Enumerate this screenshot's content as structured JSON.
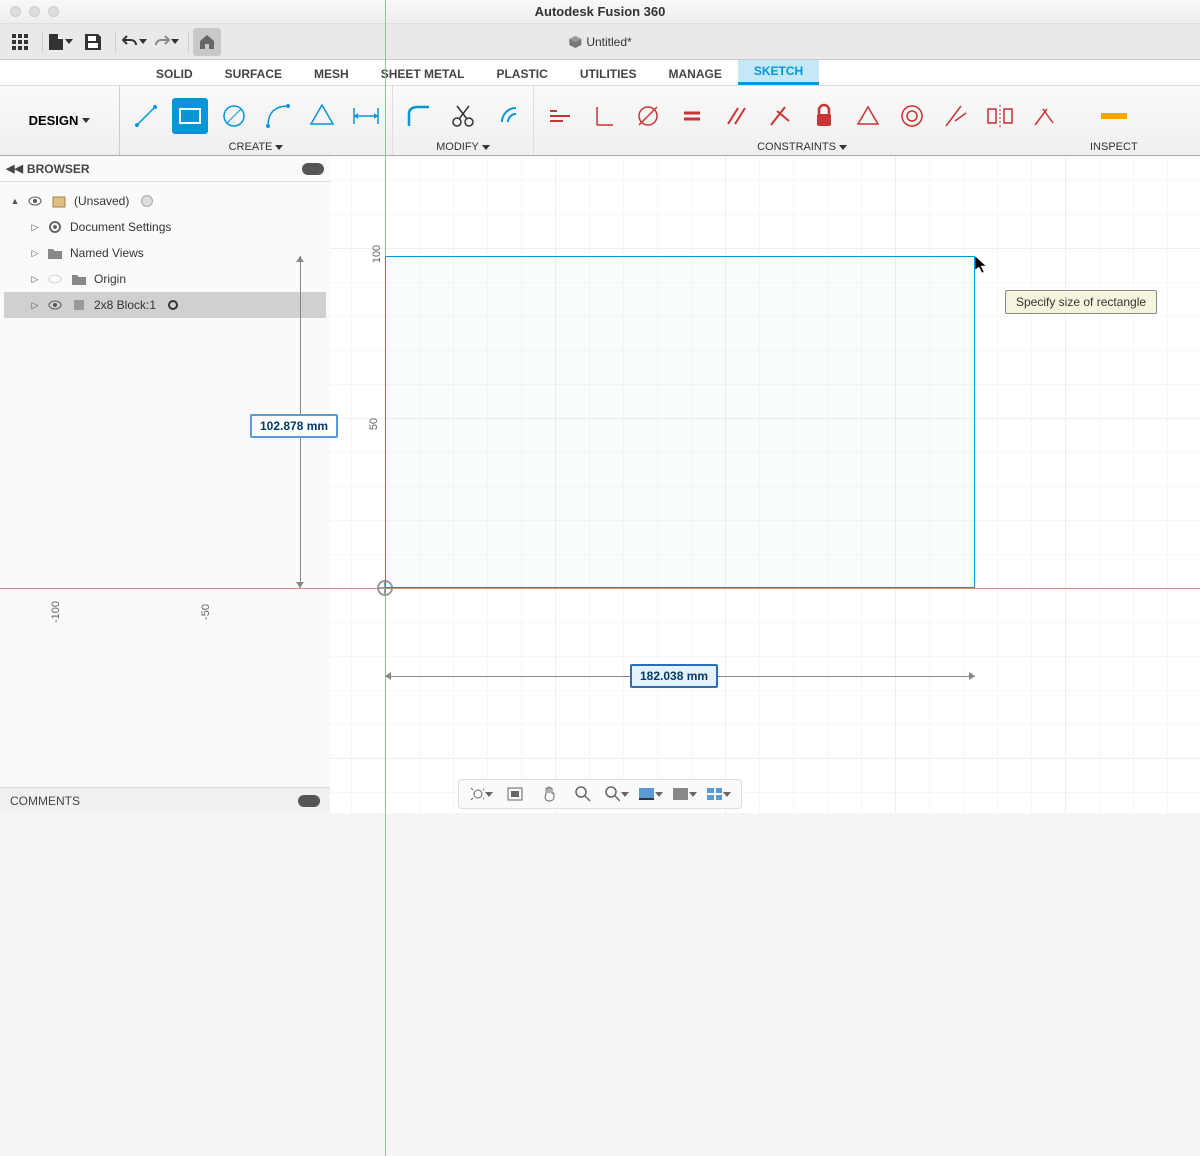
{
  "app_title": "Autodesk Fusion 360",
  "document_tab": "Untitled*",
  "workspace": "DESIGN",
  "tabs": [
    "SOLID",
    "SURFACE",
    "MESH",
    "SHEET METAL",
    "PLASTIC",
    "UTILITIES",
    "MANAGE",
    "SKETCH"
  ],
  "active_tab": "SKETCH",
  "ribbon_groups": {
    "create": "CREATE",
    "modify": "MODIFY",
    "constraints": "CONSTRAINTS",
    "inspect": "INSPECT"
  },
  "browser": {
    "title": "BROWSER",
    "items": [
      {
        "label": "(Unsaved)",
        "icon": "component"
      },
      {
        "label": "Document Settings",
        "icon": "gear"
      },
      {
        "label": "Named Views",
        "icon": "folder"
      },
      {
        "label": "Origin",
        "icon": "folder"
      },
      {
        "label": "2x8 Block:1",
        "icon": "body",
        "selected": true
      }
    ]
  },
  "canvas": {
    "y_ticks": [
      "100",
      "50",
      "-100"
    ],
    "x_tick_neg": "-50",
    "dimension_v": "102.878 mm",
    "dimension_h": "182.038 mm",
    "tooltip": "Specify size of rectangle"
  },
  "comments": "COMMENTS"
}
